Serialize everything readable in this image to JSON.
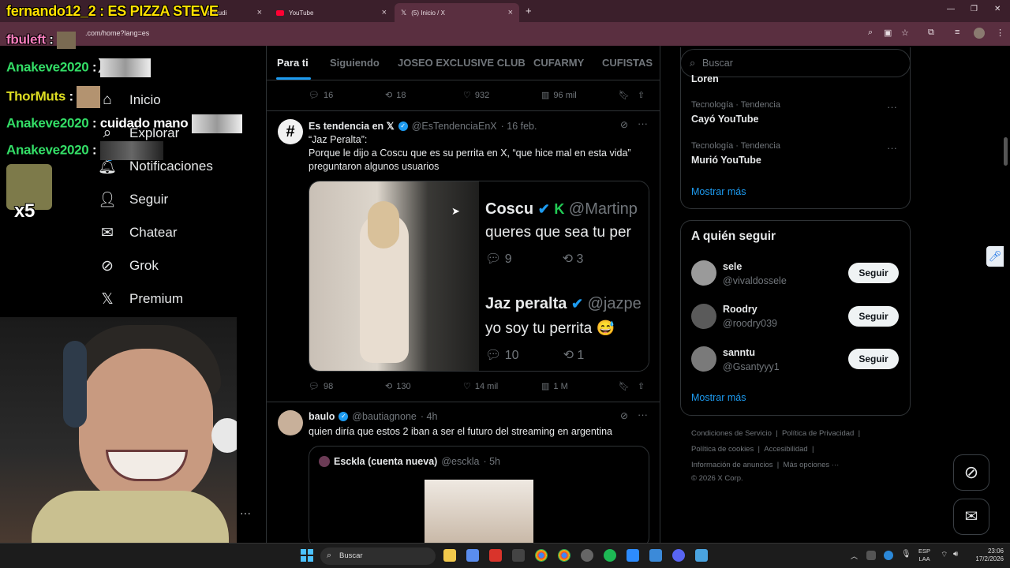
{
  "browser": {
    "tabs": [
      {
        "label": "be Studi"
      },
      {
        "label": "YouTube"
      },
      {
        "label": "(5) Inicio / X"
      }
    ],
    "url": ".com/home?lang=es",
    "new_tab": "+"
  },
  "overlay": {
    "title": "fernando12_2 : ES PIZZA STEVE",
    "chat": [
      {
        "user": "fbuleft",
        "sep": ":",
        "message": "",
        "color": "#ff7fbf"
      },
      {
        "user": "Anakeve2020",
        "sep": ":",
        "message": "",
        "color": "#33dd66"
      },
      {
        "user": "ThorMuts",
        "sep": ":",
        "message": "",
        "color": "#dddd22"
      },
      {
        "user": "Anakeve2020",
        "sep": ":",
        "message": "cuidado mano",
        "color": "#33dd66"
      },
      {
        "user": "Anakeve2020",
        "sep": ":",
        "message": "",
        "color": "#33dd66"
      }
    ],
    "multiplier": "x5",
    "more": "···"
  },
  "nav": {
    "logo": "X",
    "items": [
      {
        "label": "Inicio",
        "icon": "home-icon"
      },
      {
        "label": "Explorar",
        "icon": "search-icon"
      },
      {
        "label": "Notificaciones",
        "icon": "bell-icon",
        "badge": "5"
      },
      {
        "label": "Seguir",
        "icon": "follow-icon"
      },
      {
        "label": "Chatear",
        "icon": "mail-icon"
      },
      {
        "label": "Grok",
        "icon": "grok-icon"
      },
      {
        "label": "Premium",
        "icon": "x-icon"
      }
    ]
  },
  "feed_tabs": [
    "Para ti",
    "Siguiendo",
    "JOSEO EXCLUSIVE CLUB",
    "CUFARMY",
    "CUFISTAS"
  ],
  "feed": {
    "prev_metrics": {
      "replies": "16",
      "reposts": "18",
      "likes": "932",
      "views": "96 mil"
    },
    "post1": {
      "name": "Es tendencia en 𝕏",
      "handle": "@EsTendenciaEnX",
      "time": "· 16 feb.",
      "line1": "“Jaz Peralta”:",
      "line2": "Porque le dijo a Coscu que es su perrita en X, “que hice mal en esta vida”",
      "line3": "preguntaron algunos usuarios",
      "embed": {
        "a_name": "Coscu",
        "a_handle": "@Martinp",
        "a_text": "queres que sea tu per",
        "a_replies": "9",
        "a_reposts": "3",
        "b_name": "Jaz peralta",
        "b_handle": "@jazpe",
        "b_text": "yo soy tu perrita 😅",
        "b_replies": "10",
        "b_reposts": "1"
      },
      "metrics": {
        "replies": "98",
        "reposts": "130",
        "likes": "14 mil",
        "views": "1 M"
      }
    },
    "post2": {
      "name": "baulo",
      "handle": "@bautiagnone",
      "time": "· 4h",
      "text": "quien diría que estos 2 iban a ser el futuro del streaming en argentina",
      "quote": {
        "name": "Esckla (cuenta nueva)",
        "handle": "@esckla",
        "time": "· 5h"
      }
    }
  },
  "right": {
    "search_placeholder": "Buscar",
    "trends": [
      {
        "meta": "Tecnología · Tendencia",
        "name": "Cayó YouTube"
      },
      {
        "meta": "Tecnología · Tendencia",
        "name": "Murió YouTube"
      }
    ],
    "partial_trend": "Loren",
    "show_more": "Mostrar más",
    "who_to_follow_title": "A quién seguir",
    "follow": [
      {
        "name": "sele",
        "handle": "@vivaldossele",
        "button": "Seguir"
      },
      {
        "name": "Roodry",
        "handle": "@roodry039",
        "button": "Seguir"
      },
      {
        "name": "sanntu",
        "handle": "@Gsantyyy1",
        "button": "Seguir"
      }
    ],
    "show_more_2": "Mostrar más",
    "footer": {
      "l1": [
        "Condiciones de Servicio",
        "Política de Privacidad"
      ],
      "l2": [
        "Política de cookies",
        "Accesibilidad"
      ],
      "l3": [
        "Información de anuncios",
        "Más opciones ···"
      ],
      "copyright": "© 2026 X Corp."
    }
  },
  "taskbar": {
    "search": "Buscar",
    "lang1": "ESP",
    "lang2": "LAA",
    "time": "23:06",
    "date": "17/2/2026"
  },
  "colors": {
    "accent": "#1d9bf0",
    "tabbar": "#3b1f2b",
    "addressbar": "#5a2f40"
  }
}
